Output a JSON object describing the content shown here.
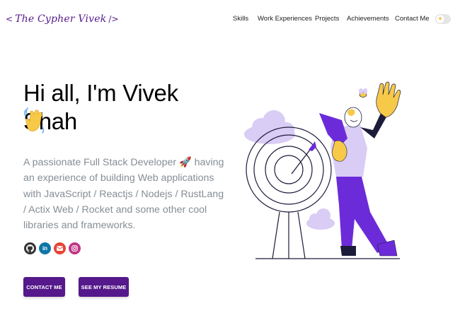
{
  "header": {
    "logo_open": "<",
    "logo_text": "The Cypher Vivek",
    "logo_close": "/>",
    "nav": [
      {
        "label": "Skills"
      },
      {
        "label": "Work Experiences"
      },
      {
        "label": "Projects"
      },
      {
        "label": "Achievements"
      },
      {
        "label": "Contact Me"
      }
    ],
    "theme_toggle": {
      "icon": "sun-icon",
      "state": "light"
    }
  },
  "hero": {
    "greeting": "Hi all, I'm Vivek Shah",
    "wave_icon": "waving-hand-icon",
    "subtitle": "A passionate Full Stack Developer 🚀 having an experience of building Web applications with JavaScript / Reactjs / Nodejs / RustLang / Actix Web / Rocket and some other cool libraries and frameworks.",
    "socials": [
      {
        "icon": "github-icon",
        "color": "#333333"
      },
      {
        "icon": "linkedin-icon",
        "color": "#0e76a8"
      },
      {
        "icon": "email-icon",
        "color": "#ea4335"
      },
      {
        "icon": "instagram-icon",
        "color": "#c13584"
      }
    ],
    "buttons": {
      "contact": "CONTACT ME",
      "resume": "SEE MY RESUME"
    }
  },
  "colors": {
    "accent": "#55198b",
    "text_secondary": "#868e96",
    "illustration_purple": "#6c2bd9",
    "illustration_yellow": "#f7c948",
    "cloud": "#d9ccf5"
  }
}
